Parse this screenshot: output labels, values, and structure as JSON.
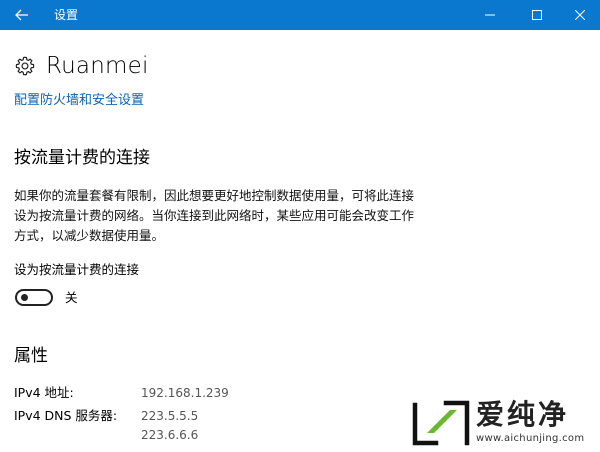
{
  "window": {
    "title": "设置"
  },
  "header": {
    "icon": "gear-icon",
    "title": "Ruanmei"
  },
  "links": {
    "firewall": "配置防火墙和安全设置"
  },
  "metered": {
    "section_title": "按流量计费的连接",
    "description": "如果你的流量套餐有限制，因此想要更好地控制数据使用量，可将此连接设为按流量计费的网络。当你连接到此网络时，某些应用可能会改变工作方式，以减少数据使用量。",
    "toggle_label": "设为按流量计费的连接",
    "toggle_state": "关",
    "toggle_on": false
  },
  "properties": {
    "section_title": "属性",
    "rows": [
      {
        "label": "IPv4 地址:",
        "values": [
          "192.168.1.239"
        ]
      },
      {
        "label": "IPv4 DNS 服务器:",
        "values": [
          "223.5.5.5",
          "223.6.6.6"
        ]
      }
    ]
  },
  "watermark": {
    "brand": "爱纯净",
    "url": "www.aichunjing.com"
  },
  "colors": {
    "titlebar": "#0b78d0",
    "link": "#0b63b3"
  }
}
